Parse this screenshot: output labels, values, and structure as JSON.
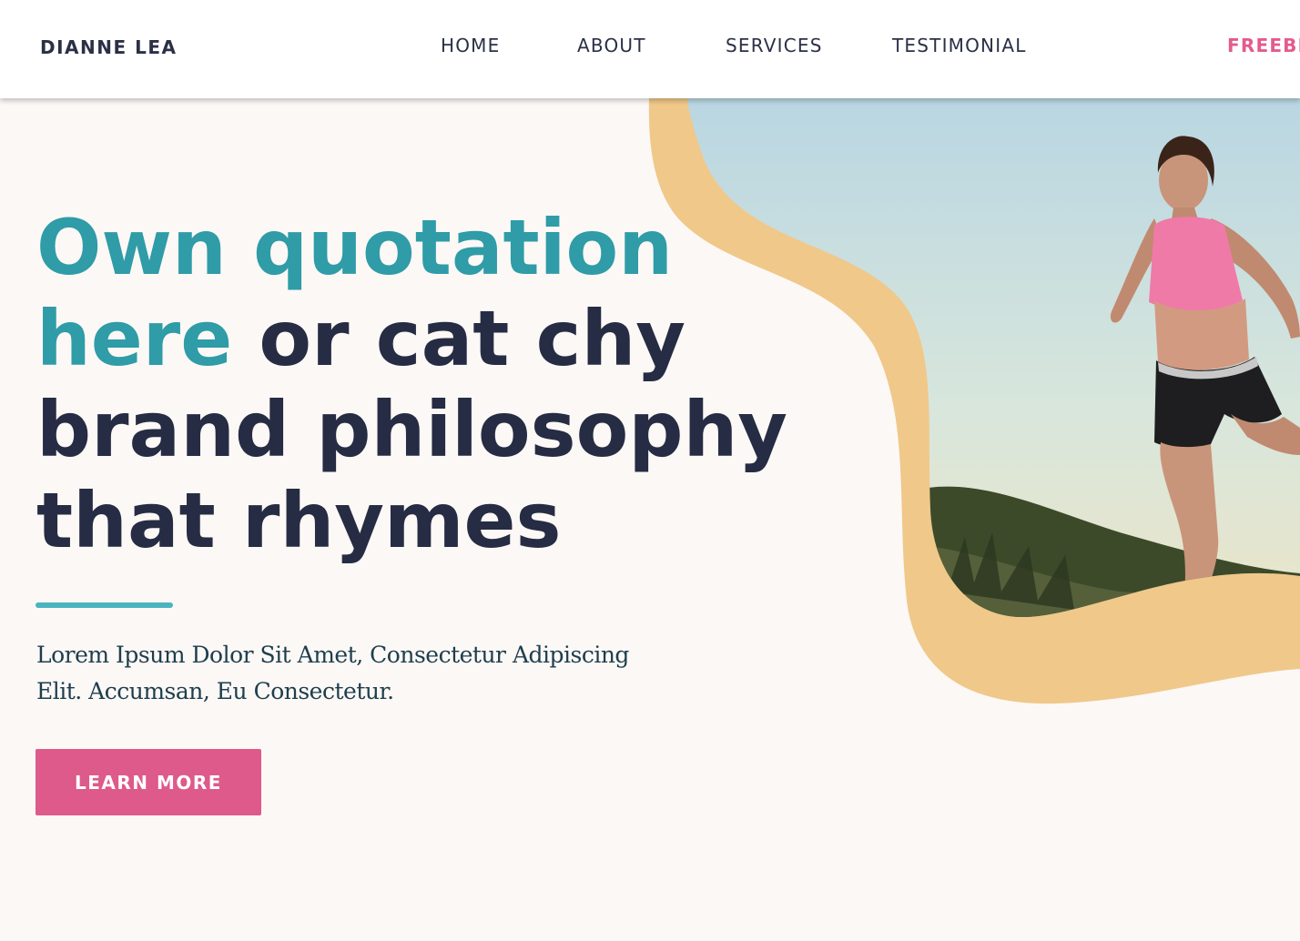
{
  "nav": {
    "brand": "DIANNE LEA",
    "links": [
      "HOME",
      "ABOUT",
      "SERVICES",
      "TESTIMONIAL"
    ],
    "freebie": "FREEBI"
  },
  "hero": {
    "headline_teal_1": "Own quotation",
    "headline_teal_2": "here",
    "headline_rest_1": "or cat chy",
    "headline_rest_2": "brand philosophy",
    "headline_rest_3": "that rhymes",
    "body": "Lorem Ipsum Dolor Sit Amet, Consectetur Adipiscing Elit. Accumsan, Eu Consectetur.",
    "cta_label": "LEARN MORE",
    "image_icon": "woman-running-photo"
  },
  "colors": {
    "background": "#fcf8f6",
    "teal": "#2f9ca7",
    "navy": "#262c43",
    "pink": "#dd5a8a",
    "blob": "#f0c88a"
  }
}
